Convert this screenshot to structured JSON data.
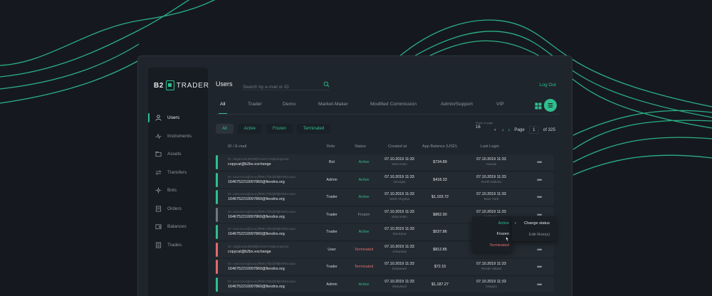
{
  "brand": {
    "part1": "B2",
    "part2": "TRADER"
  },
  "colors": {
    "accent": "#2fbf8f",
    "danger": "#e26b6b",
    "muted": "#6f7884",
    "background": "#15191f",
    "panel": "#1f252c"
  },
  "sidebar": {
    "items": [
      {
        "label": "Users",
        "icon": "user-icon",
        "active": true
      },
      {
        "label": "Instruments",
        "icon": "pulse-icon",
        "active": false
      },
      {
        "label": "Assets",
        "icon": "folder-icon",
        "active": false
      },
      {
        "label": "Transfers",
        "icon": "transfer-icon",
        "active": false
      },
      {
        "label": "Bots",
        "icon": "bot-icon",
        "active": false
      },
      {
        "label": "Orders",
        "icon": "orders-icon",
        "active": false
      },
      {
        "label": "Balances",
        "icon": "wallet-icon",
        "active": false
      },
      {
        "label": "Trades",
        "icon": "list-icon",
        "active": false
      }
    ]
  },
  "header": {
    "title": "Users",
    "search_placeholder": "Search by e-mail or ID",
    "logout": "Log Out"
  },
  "tabs": [
    {
      "label": "All",
      "active": true
    },
    {
      "label": "Trader",
      "active": false
    },
    {
      "label": "Demo",
      "active": false
    },
    {
      "label": "Market-Maker",
      "active": false
    },
    {
      "label": "Modified Commission",
      "active": false
    },
    {
      "label": "Admin/Support",
      "active": false
    },
    {
      "label": "VIP",
      "active": false
    }
  ],
  "filters": [
    {
      "label": "All",
      "active": true
    },
    {
      "label": "Active",
      "active": false
    },
    {
      "label": "Frozen",
      "active": false
    },
    {
      "label": "Terminated",
      "active": false
    }
  ],
  "pagination": {
    "rows_label": "Rows on page",
    "rows_value": "16",
    "page_label": "Page",
    "page": "1",
    "of": "of 325"
  },
  "table": {
    "columns": [
      "ID / E-mail",
      "Role",
      "Status",
      "Created at",
      "App Balance (USD)",
      "Last Login"
    ],
    "rows": [
      {
        "id": "ID: dagba1843fb98fjhuhd3719djkuhg8182",
        "email": "copycat@b2bx.exchange",
        "role": "Bot",
        "status": "Active",
        "created": "07.10.2019 11:33",
        "created_loc": "Wisconsin",
        "balance": "$734.89",
        "last_login": "07.10.2019 11:33",
        "last_loc": "Hawaii",
        "bar": "green"
      },
      {
        "id": "ID: axxxxxxxxjjhuuuyffi8917fjhdjhf8jkh9914aaa",
        "email": "1646752210097860@fiexdns.org",
        "role": "Admin",
        "status": "Active",
        "created": "07.10.2019 11:33",
        "created_loc": "Georgia",
        "balance": "$418.33",
        "last_login": "07.10.2019 11:33",
        "last_loc": "North Dakota",
        "bar": "green"
      },
      {
        "id": "ID: axxxxxxxxjjhuuuyffi8917fjhdjhf8jkh9914aaa",
        "email": "1646752210097860@fiexdns.org",
        "role": "Trader",
        "status": "Active",
        "created": "07.10.2019 11:33",
        "created_loc": "West Virginia",
        "balance": "$1,103.72",
        "last_login": "07.10.2019 11:33",
        "last_loc": "New York",
        "bar": "green"
      },
      {
        "id": "ID: axxxxxxxxjjhuuuyffi8917fjhdjhf8jkh9914aaa",
        "email": "1646752210097860@fiexdns.org",
        "role": "Trader",
        "status": "Frozen",
        "created": "07.10.2019 11:33",
        "created_loc": "Wisconsin",
        "balance": "$862.90",
        "last_login": "07.10.2019 11:33",
        "last_loc": "California",
        "bar": "gray"
      },
      {
        "id": "ID: axxxxxxxxjjhuuuyffi8917fjhdjhf8jkh9914aaa",
        "email": "1646752210097860@fiexdns.org",
        "role": "Trader",
        "status": "Active",
        "created": "07.10.2019 11:33",
        "created_loc": "Montana",
        "balance": "$537.86",
        "last_login": "07.10.2019 11:33",
        "last_loc": "",
        "bar": "green"
      },
      {
        "id": "ID: dagba1843fb98fjhuhd3719djkuhg8182",
        "email": "copycat@b2bx.exchange",
        "role": "User",
        "status": "Terminated",
        "created": "07.10.2019 11:33",
        "created_loc": "Arkansas",
        "balance": "$812.85",
        "last_login": "07.10.2019 11:33",
        "last_loc": "",
        "bar": "red"
      },
      {
        "id": "ID: axxxxxxxxjjhuuuyffi8917fjhdjhf8jkh9914aaa",
        "email": "1646752210097860@fiexdns.org",
        "role": "Trader",
        "status": "Terminated",
        "created": "07.10.2019 11:33",
        "created_loc": "Delaware",
        "balance": "$72.15",
        "last_login": "07.10.2019 11:33",
        "last_loc": "Rhode Island",
        "bar": "red"
      },
      {
        "id": "ID: axxxxxxxxjjhuuuyffi8917fjhdjhf8jkh9914aaa",
        "email": "1646752210097860@fiexdns.org",
        "role": "Admin",
        "status": "Active",
        "created": "07.10.2019 11:33",
        "created_loc": "Maryland",
        "balance": "$1,187.27",
        "last_login": "07.10.2019 11:33",
        "last_loc": "Oregon",
        "bar": "green"
      }
    ]
  },
  "status_menu": {
    "options": [
      "Active",
      "Frozen",
      "Terminated"
    ]
  },
  "row_menu": {
    "change_status": "Change status",
    "edit_roles": "Edit Role(s)"
  }
}
